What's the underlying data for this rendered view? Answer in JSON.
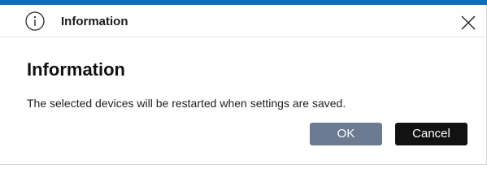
{
  "dialog": {
    "title": "Information",
    "heading": "Information",
    "message": "The selected devices will be restarted when settings are saved.",
    "ok_label": "OK",
    "cancel_label": "Cancel",
    "icons": {
      "title_icon": "info-icon",
      "close_icon": "close-icon"
    },
    "colors": {
      "accent": "#0f6db8",
      "ok_button_bg": "#6c7b91",
      "cancel_button_bg": "#121212"
    }
  }
}
